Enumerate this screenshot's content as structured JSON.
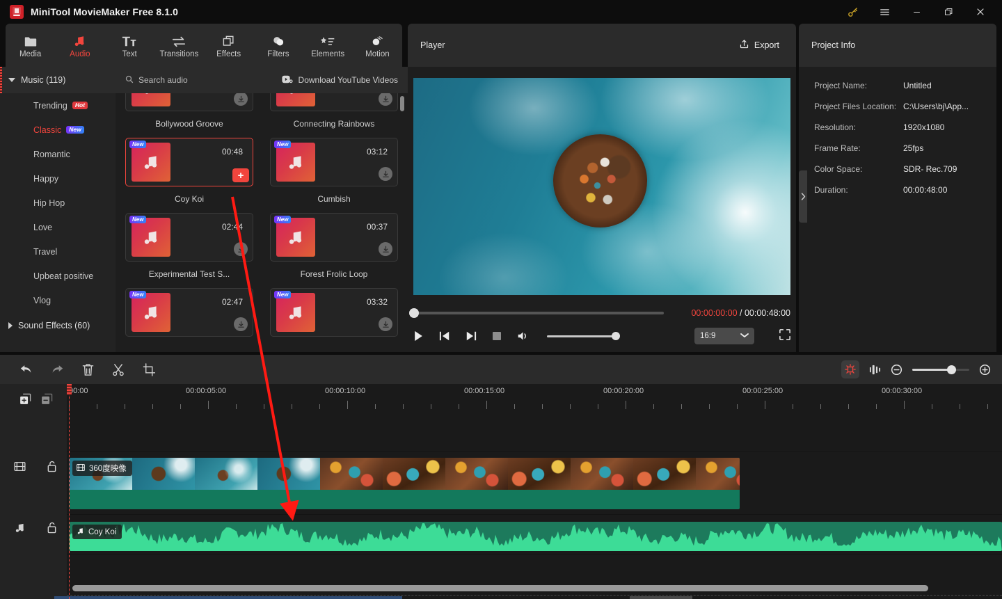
{
  "titlebar": {
    "app_name": "MiniTool MovieMaker Free 8.1.0",
    "logo_text": "M",
    "buttons": [
      {
        "name": "key-icon",
        "glyph": "key"
      },
      {
        "name": "menu-icon",
        "glyph": "menu"
      },
      {
        "name": "minimize-icon",
        "glyph": "minimize"
      },
      {
        "name": "restore-icon",
        "glyph": "restore"
      },
      {
        "name": "close-icon",
        "glyph": "close"
      }
    ]
  },
  "modules": [
    {
      "label": "Media",
      "icon": "folder-icon",
      "active": false
    },
    {
      "label": "Audio",
      "icon": "music-note-icon",
      "active": true
    },
    {
      "label": "Text",
      "icon": "text-icon",
      "active": false
    },
    {
      "label": "Transitions",
      "icon": "transitions-icon",
      "active": false
    },
    {
      "label": "Effects",
      "icon": "effects-icon",
      "active": false
    },
    {
      "label": "Filters",
      "icon": "filters-icon",
      "active": false
    },
    {
      "label": "Elements",
      "icon": "elements-icon",
      "active": false
    },
    {
      "label": "Motion",
      "icon": "motion-icon",
      "active": false
    }
  ],
  "categories": {
    "music_group": "Music (119)",
    "items": [
      {
        "label": "Trending",
        "badge": "Hot",
        "badge_type": "hot",
        "active": false
      },
      {
        "label": "Classic",
        "badge": "New",
        "badge_type": "new",
        "active": true
      },
      {
        "label": "Romantic",
        "badge": "",
        "badge_type": "",
        "active": false
      },
      {
        "label": "Happy",
        "badge": "",
        "badge_type": "",
        "active": false
      },
      {
        "label": "Hip Hop",
        "badge": "",
        "badge_type": "",
        "active": false
      },
      {
        "label": "Love",
        "badge": "",
        "badge_type": "",
        "active": false
      },
      {
        "label": "Travel",
        "badge": "",
        "badge_type": "",
        "active": false
      },
      {
        "label": "Upbeat positive",
        "badge": "",
        "badge_type": "",
        "active": false
      },
      {
        "label": "Vlog",
        "badge": "",
        "badge_type": "",
        "active": false
      }
    ],
    "sound_effects_group": "Sound Effects (60)"
  },
  "audio_panel": {
    "search_placeholder": "Search audio",
    "download_label": "Download YouTube Videos",
    "cards": [
      {
        "name": "Bollywood Groove",
        "duration": "",
        "new": false,
        "selected": false,
        "partial": true
      },
      {
        "name": "Connecting Rainbows",
        "duration": "",
        "new": false,
        "selected": false,
        "partial": true
      },
      {
        "name": "Coy Koi",
        "duration": "00:48",
        "new": true,
        "selected": true,
        "partial": false
      },
      {
        "name": "Cumbish",
        "duration": "03:12",
        "new": true,
        "selected": false,
        "partial": false
      },
      {
        "name": "Experimental Test S...",
        "duration": "02:44",
        "new": true,
        "selected": false,
        "partial": false
      },
      {
        "name": "Forest Frolic Loop",
        "duration": "00:37",
        "new": true,
        "selected": false,
        "partial": false
      },
      {
        "name": "",
        "duration": "02:47",
        "new": true,
        "selected": false,
        "partial": true
      },
      {
        "name": "",
        "duration": "03:32",
        "new": true,
        "selected": false,
        "partial": true
      }
    ],
    "new_badge": "New",
    "add_button_label": "+"
  },
  "player": {
    "title": "Player",
    "export_label": "Export",
    "current_time": "00:00:00:00",
    "separator": " / ",
    "total_time": "00:00:48:00",
    "aspect_ratio": "16:9",
    "controls": [
      "play-button",
      "prev-frame-button",
      "next-frame-button",
      "stop-button",
      "volume-button",
      "fullscreen-button"
    ]
  },
  "project_info": {
    "title": "Project Info",
    "rows": [
      {
        "label": "Project Name:",
        "value": "Untitled"
      },
      {
        "label": "Project Files Location:",
        "value": "C:\\Users\\bj\\App..."
      },
      {
        "label": "Resolution:",
        "value": "1920x1080"
      },
      {
        "label": "Frame Rate:",
        "value": "25fps"
      },
      {
        "label": "Color Space:",
        "value": "SDR- Rec.709"
      },
      {
        "label": "Duration:",
        "value": "00:00:48:00"
      }
    ]
  },
  "timeline": {
    "tools": [
      "undo-icon",
      "redo-icon",
      "delete-icon",
      "split-icon",
      "crop-icon"
    ],
    "right_tools": [
      "auto-detect-icon",
      "audio-split-icon",
      "zoom-out-icon",
      "zoom-slider",
      "zoom-in-icon"
    ],
    "track_header_tools": [
      "add-track-icon",
      "remove-track-icon"
    ],
    "ruler_labels": [
      "00:00",
      "00:00:05:00",
      "00:00:10:00",
      "00:00:15:00",
      "00:00:20:00",
      "00:00:25:00",
      "00:00:30:00"
    ],
    "video_clip_label": "360度映像",
    "audio_clip_label": "Coy Koi",
    "tracks": [
      {
        "type": "video",
        "lock": "unlocked"
      },
      {
        "type": "audio",
        "lock": "unlocked"
      }
    ]
  },
  "colors": {
    "accent_red": "#f1453d",
    "panel_bg": "#1e1e1e",
    "toolbar_bg": "#2b2b2b",
    "video_clip_green": "#13795c",
    "audio_clip_green": "#1d7a5c",
    "waveform_green": "#3ddc97"
  }
}
